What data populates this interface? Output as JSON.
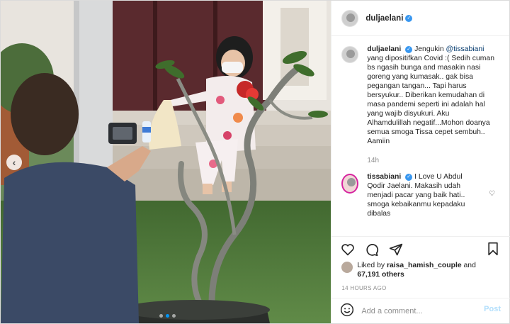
{
  "header": {
    "username": "duljaelani"
  },
  "caption": {
    "username": "duljaelani",
    "prefix": "Jengukin ",
    "mention": "@tissabiani",
    "text": "yang dipositifkan Covid :( Sedih cuman bs ngasih bunga and masakin nasi goreng yang kumasak.. gak bisa pegangan tangan... Tapi harus bersyukur.. Diberikan kemudahan di masa pandemi seperti ini adalah hal yang wajib disyukuri. Aku Alhamdulillah negatif...Mohon doanya semua smoga Tissa cepet sembuh.. Aamiin",
    "age": "14h"
  },
  "reply": {
    "username": "tissabiani",
    "text": "I Love U Abdul Qodir Jaelani. Makasih udah menjadi pacar yang baik hati.. smoga kebaikanmu kepadaku dibalas"
  },
  "likes": {
    "prefix": "Liked by ",
    "user": "raisa_hamish_couple",
    "conjunction": " and",
    "count": "67,191 others"
  },
  "timestamp": "14 HOURS AGO",
  "comment_box": {
    "placeholder": "Add a comment...",
    "post_label": "Post"
  },
  "icons": {
    "verified": "verified-badge",
    "like": "heart-icon",
    "comment": "comment-icon",
    "share": "paper-plane-icon",
    "save": "bookmark-icon",
    "emoji": "smiley-icon",
    "prev": "chevron-left-icon"
  },
  "colors": {
    "verified": "#3897f0",
    "post_disabled": "#b2dffc",
    "mention": "#00376b",
    "active_dot": "#0095f6"
  }
}
